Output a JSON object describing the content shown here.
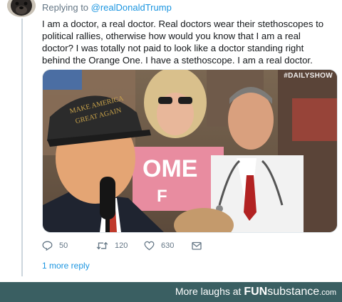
{
  "tweet": {
    "reply_prefix": "Replying to ",
    "reply_handle": "@realDonaldTrump",
    "text": "I am a doctor, a real doctor. Real doctors wear their stethoscopes to political rallies, otherwise how would you know that I am a real doctor? I was totally not paid to look like a doctor standing right behind the Orange One. I have a stethoscope. I am a real doctor.",
    "media": {
      "watermark": "#DAILYSHOW",
      "cap_text_line1": "MAKE AMERICA",
      "cap_text_line2": "GREAT AGAIN",
      "sign_text_line1": "OME",
      "sign_text_line2": "F"
    },
    "actions": {
      "reply_count": "50",
      "retweet_count": "120",
      "like_count": "630"
    },
    "more_replies": "1 more reply"
  },
  "footer": {
    "prefix": "More laughs at ",
    "brand_bold": "FUN",
    "brand_rest": "substance",
    "brand_tld": ".com"
  },
  "icons": {
    "reply": "reply-icon",
    "retweet": "retweet-icon",
    "like": "like-icon",
    "message": "message-icon"
  },
  "colors": {
    "link": "#1b95e0",
    "muted": "#657786",
    "footer_bg": "#3a5f62"
  }
}
